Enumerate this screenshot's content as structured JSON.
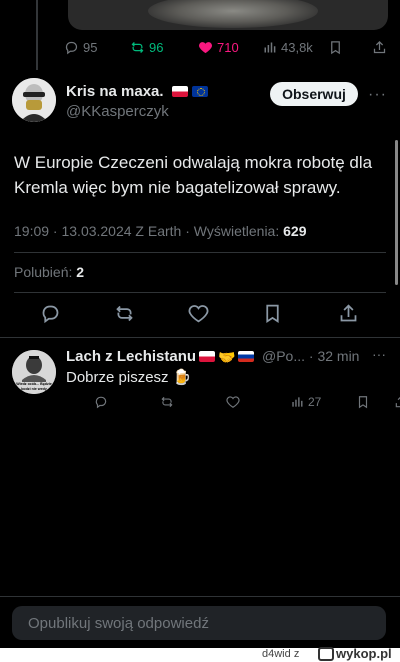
{
  "previous_tweet": {
    "stats": {
      "replies": "95",
      "retweets": "96",
      "likes": "710",
      "views": "43,8k"
    }
  },
  "tweet": {
    "author_name": "Kris na maxa.",
    "author_flags": [
      "poland-flag",
      "eu-flag"
    ],
    "handle": "@KKasperczyk",
    "follow_label": "Obserwuj",
    "more_label": "···",
    "text": "W Europie Czeczeni odwalają mokra robotę dla Kremla więc bym nie bagatelizował sprawy.",
    "meta_prefix": "19:09 · 13.03.2024 Z Earth · Wyświetlenia: ",
    "views": "629",
    "likes_label": "Polubień: ",
    "likes_count": "2"
  },
  "reply": {
    "author_name": "Lach z Lechistanu",
    "author_flags": [
      "poland-flag",
      "handshake-emoji",
      "russia-flag"
    ],
    "handle_time": "@Po... · 32 min",
    "more_label": "···",
    "avatar_caption": "Wiedz ocób... Będzie bodzi nie wedy",
    "text": "Dobrze piszesz",
    "text_emoji": "🍺",
    "stats": {
      "views": "27"
    }
  },
  "compose": {
    "placeholder": "Opublikuj swoją odpowiedź"
  },
  "footer": {
    "user": "d4wid",
    "user_suffix": "z",
    "logo_text": "wykop.pl"
  },
  "colors": {
    "background": "#000000",
    "text": "#e7e9ea",
    "muted": "#71767b",
    "retweet_green": "#00ba7c",
    "like_pink": "#f91880",
    "divider": "#2f3336"
  }
}
